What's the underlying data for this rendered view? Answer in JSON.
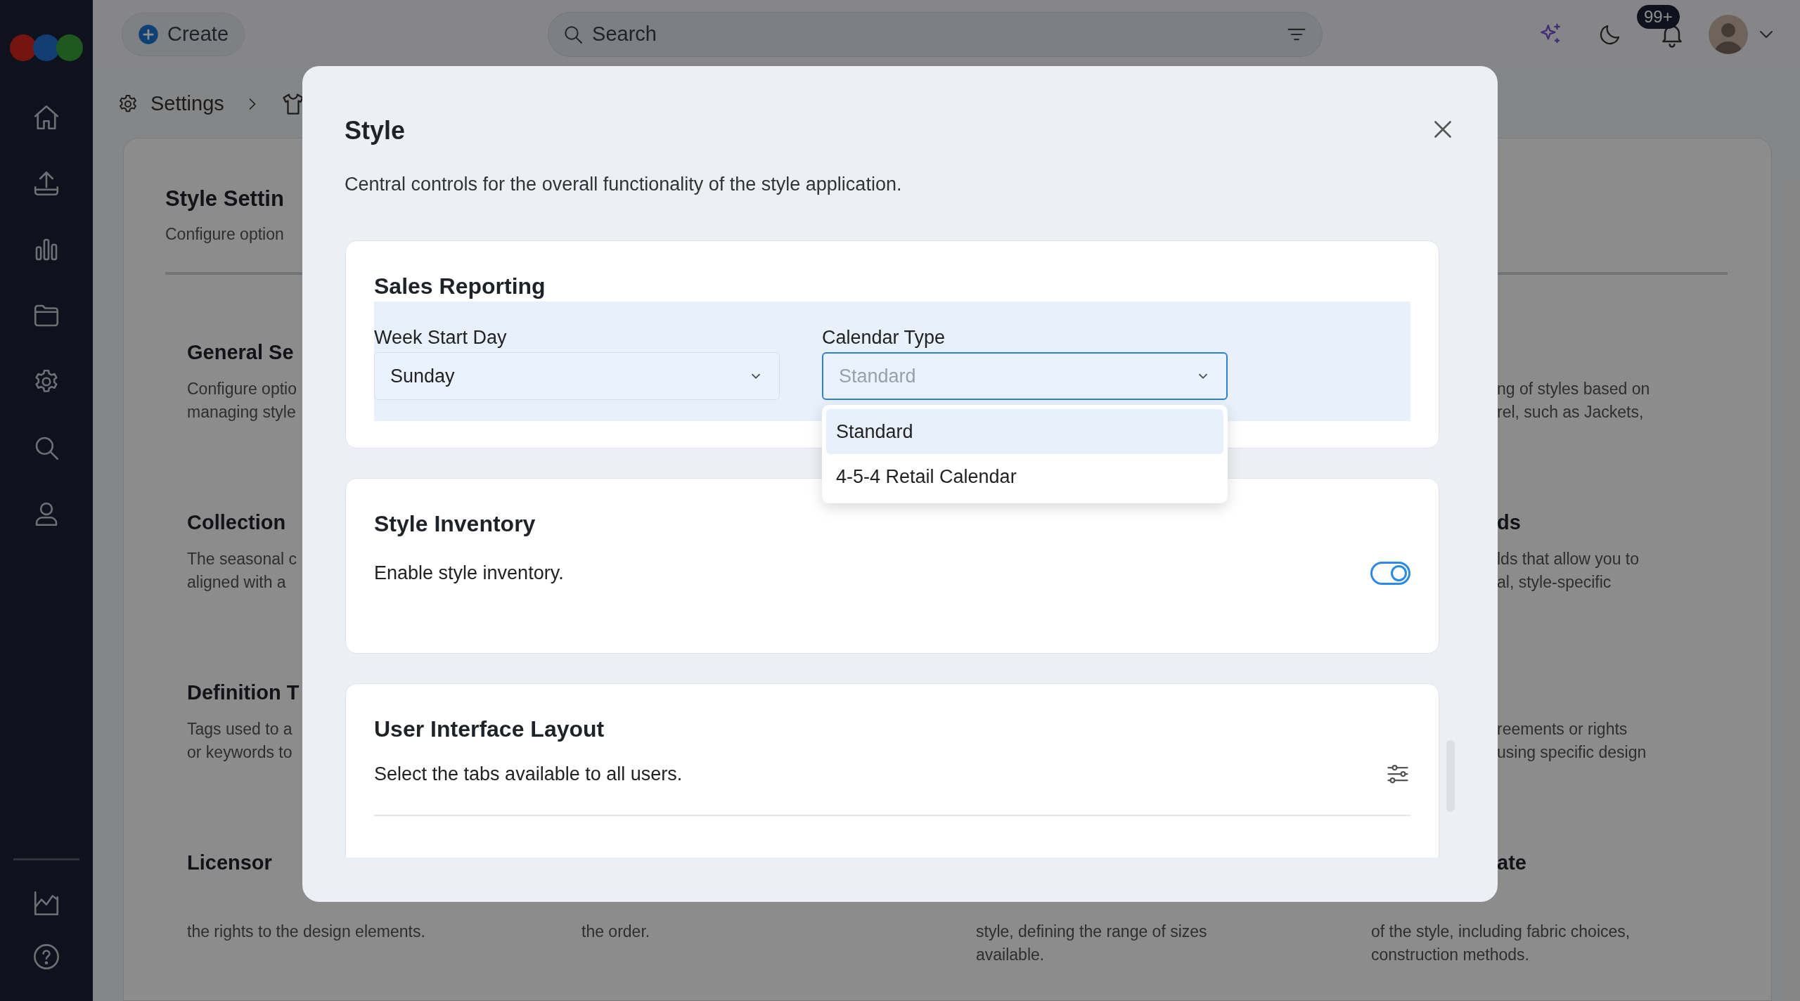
{
  "top_bar": {
    "create_button": "Create",
    "search": {
      "placeholder": "Search"
    },
    "notification_badge": "99+"
  },
  "breadcrumb": [
    {
      "label": "Settings"
    }
  ],
  "page": {
    "title": "Style Settin",
    "subtitle": "Configure option",
    "left_sections": [
      {
        "heading": "General Se",
        "lines": [
          "Configure optio",
          "managing style"
        ]
      },
      {
        "heading": "Collection",
        "lines": [
          "The seasonal c",
          "aligned with a"
        ]
      },
      {
        "heading": "Definition T",
        "lines": [
          "Tags used to a",
          "or keywords to"
        ]
      },
      {
        "heading": "Licensor"
      }
    ],
    "right_sections": [
      {
        "lines": [
          "ng of styles based on",
          "rel, such as Jackets,"
        ]
      },
      {
        "heading": "ds",
        "lines": [
          "lds that allow you to",
          "al, style-specific"
        ]
      },
      {
        "lines": [
          "reements or rights",
          "using specific design"
        ]
      },
      {
        "heading": "ate"
      }
    ],
    "bottom_lines": [
      [
        "the rights to the design elements."
      ],
      [
        "the order."
      ],
      [
        "style, defining the range of sizes",
        "available."
      ],
      [
        "of the style, including fabric choices,",
        "construction methods."
      ]
    ]
  },
  "modal": {
    "title": "Style",
    "description": "Central controls for the overall functionality of the style application.",
    "sections": [
      {
        "kind": "fields",
        "title": "Sales Reporting",
        "fields": [
          {
            "label": "Week Start Day",
            "value": "Sunday",
            "open": false
          },
          {
            "label": "Calendar Type",
            "placeholder": "Standard",
            "open": true,
            "options": [
              {
                "label": "Standard",
                "selected": true
              },
              {
                "label": "4-5-4 Retail Calendar",
                "selected": false
              }
            ]
          }
        ]
      },
      {
        "kind": "toggles",
        "title": "Style Inventory",
        "rows": [
          {
            "label": "Enable style inventory.",
            "on": true
          }
        ]
      },
      {
        "kind": "settings",
        "title": "User Interface Layout",
        "rows": [
          {
            "label": "Select the tabs available to all users."
          }
        ]
      }
    ]
  }
}
